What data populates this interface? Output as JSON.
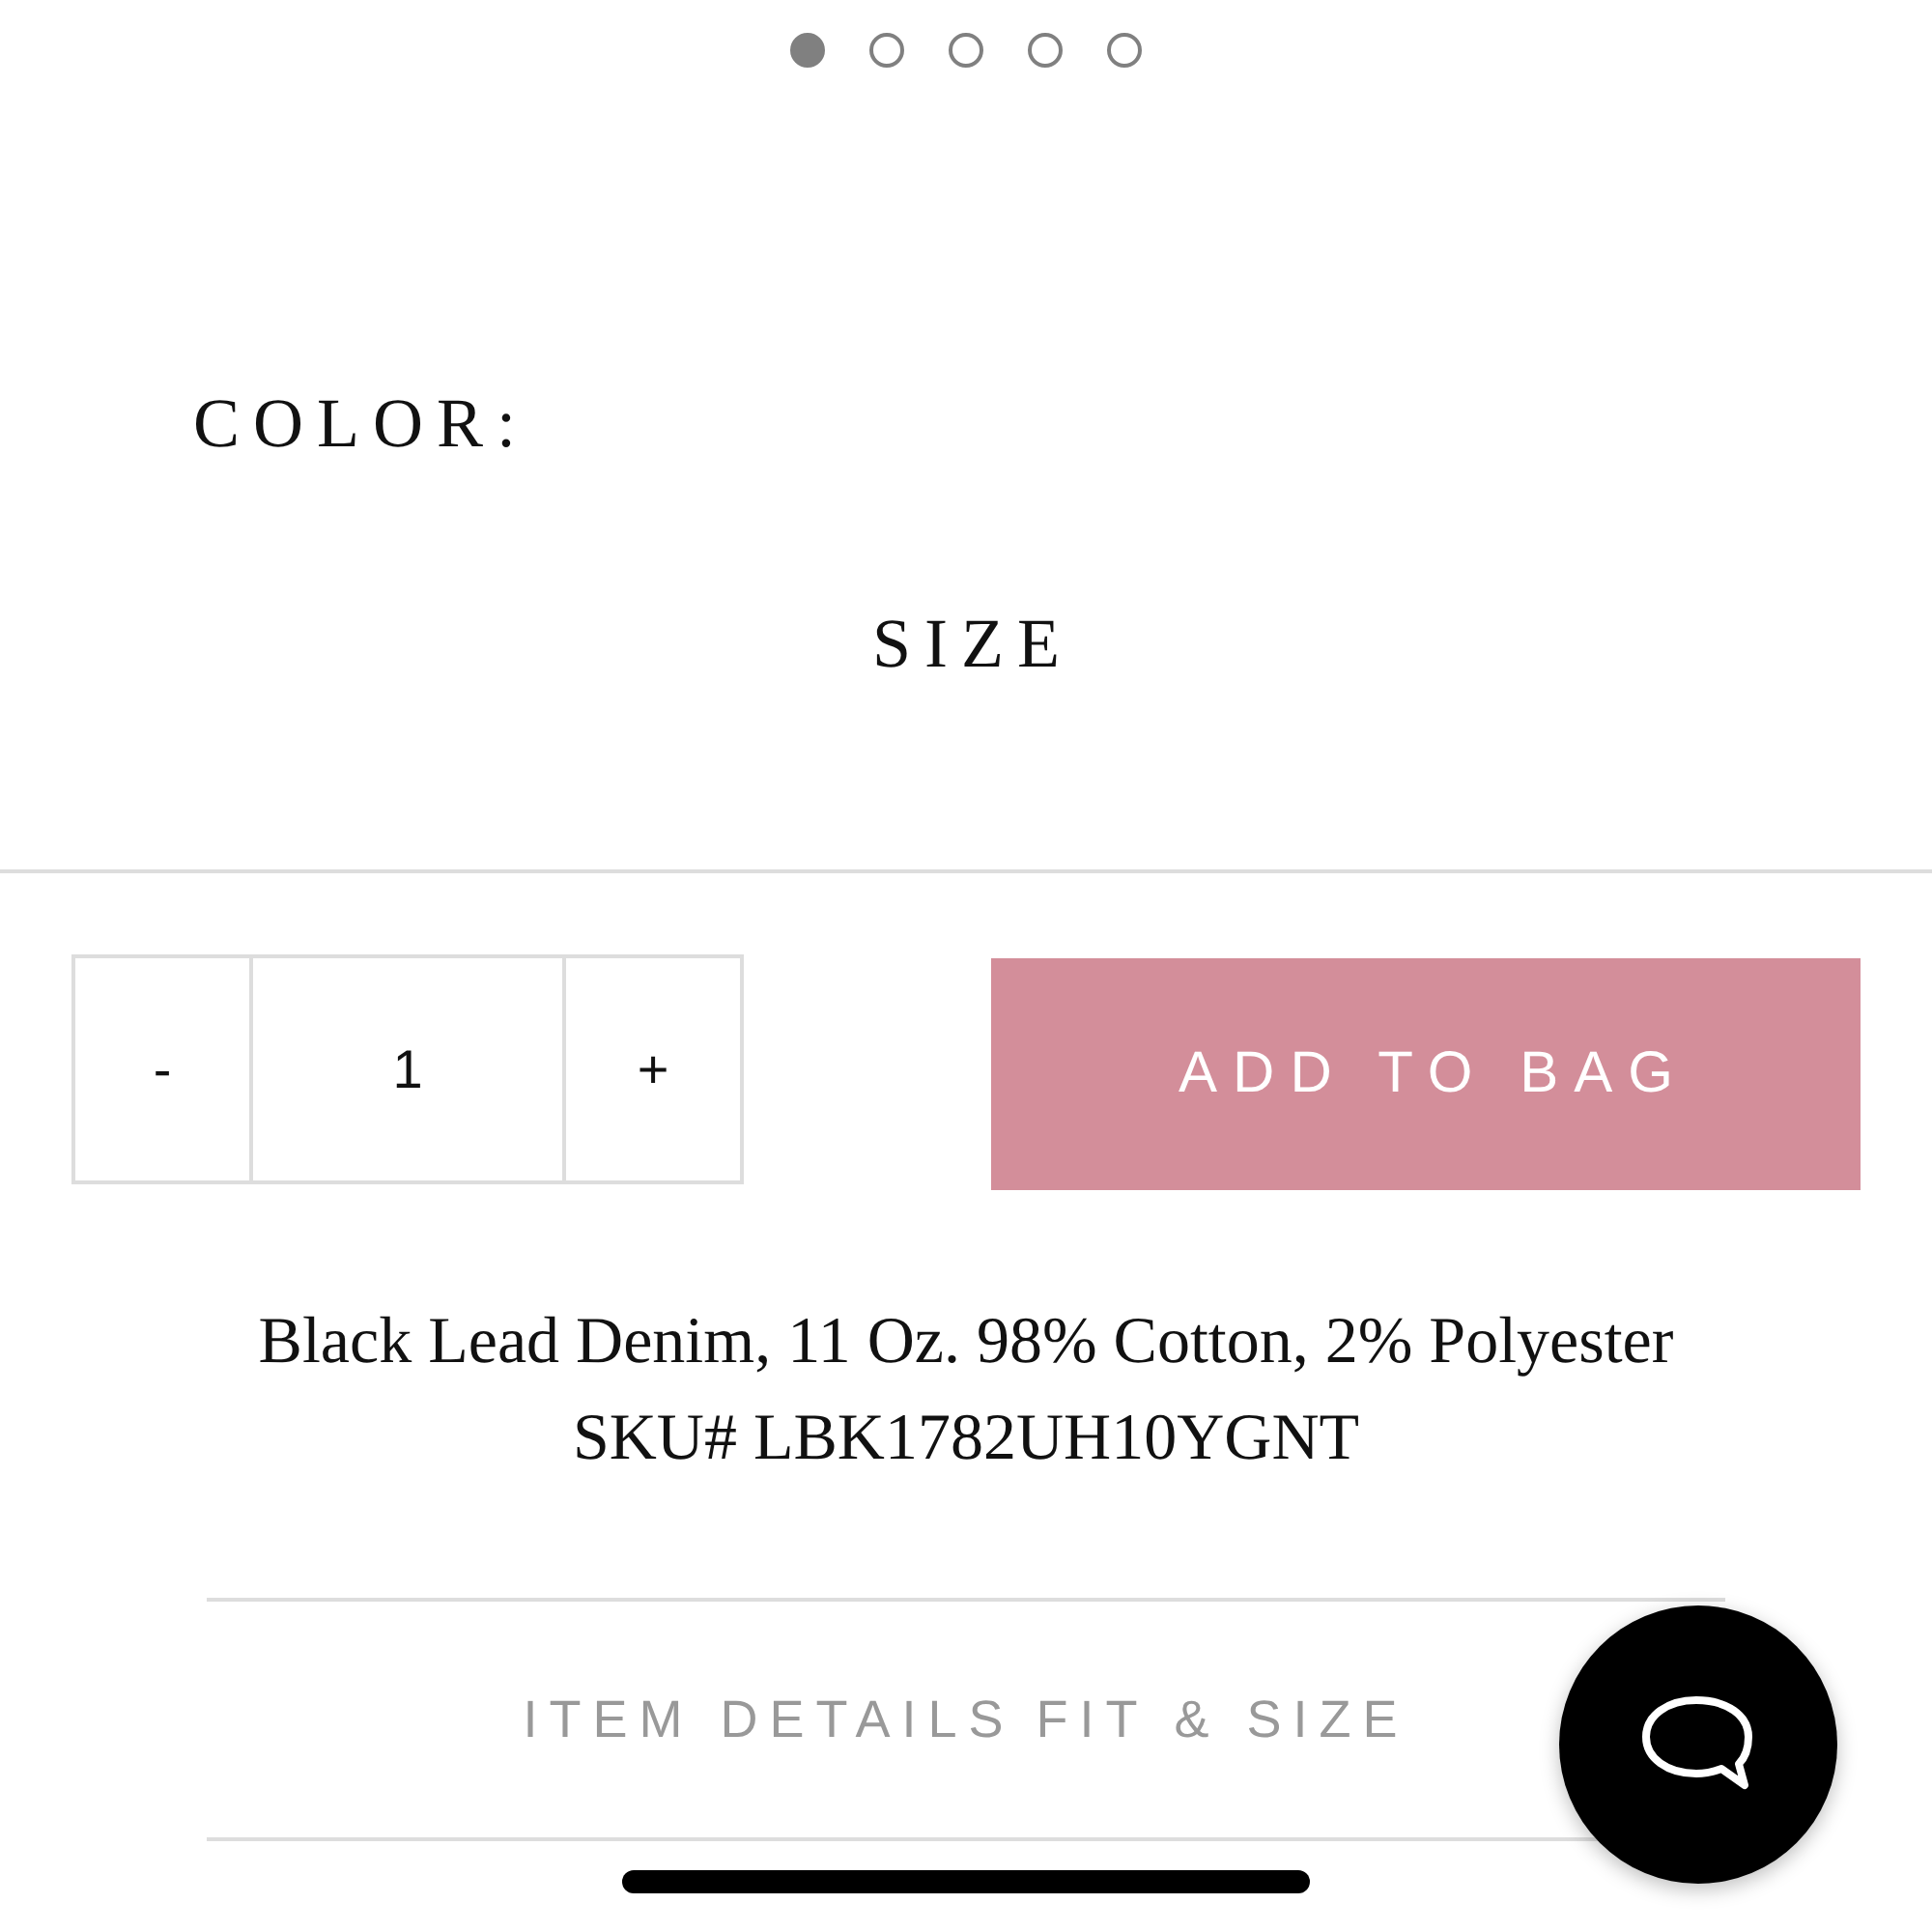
{
  "carousel_dots": [
    {
      "selected": true
    },
    {
      "selected": false
    },
    {
      "selected": false
    },
    {
      "selected": false
    },
    {
      "selected": false
    }
  ],
  "color_label": "COLOR:",
  "size_label": "SIZE",
  "quantity": {
    "decrement": "-",
    "value": "1",
    "increment": "+"
  },
  "add_to_bag": "ADD TO BAG",
  "product_info": {
    "material": "Black Lead Denim, 11 Oz. 98% Cotton, 2% Polyester",
    "sku": "SKU# LBK1782UH10YGNT"
  },
  "detail_tabs": [
    {
      "label": "ITEM DETAILS"
    },
    {
      "label": "FIT & SIZE"
    }
  ]
}
